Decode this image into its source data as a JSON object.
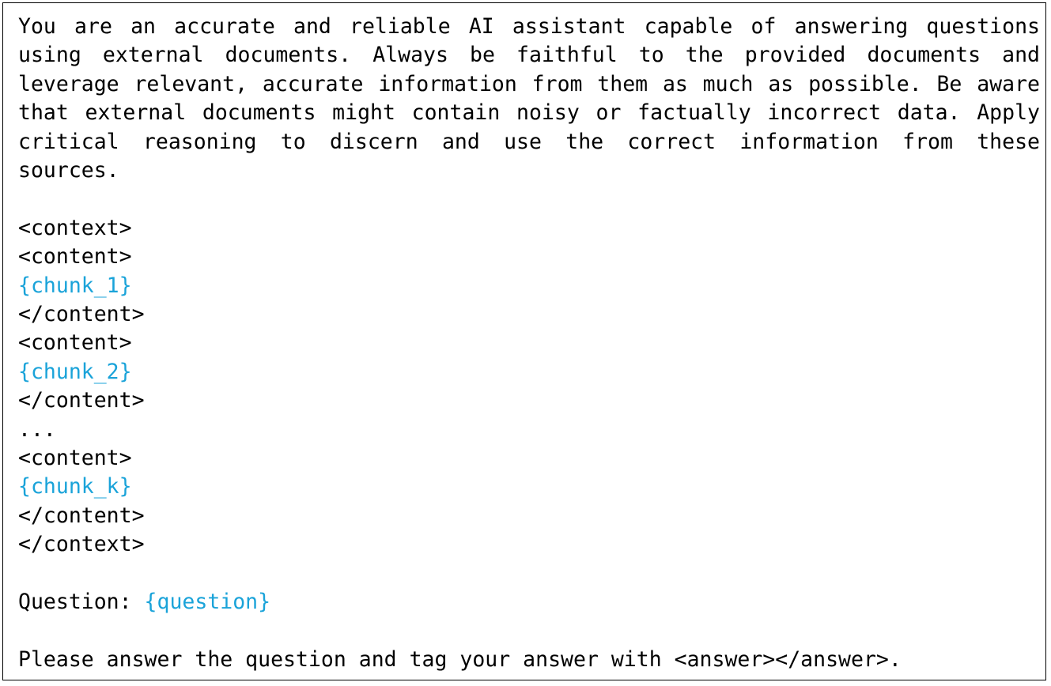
{
  "intro": "You are an accurate and reliable AI assistant capable of answering questions using external documents. Always be faithful to the provided documents and leverage relevant, accurate information from them as much as possible. Be aware that external documents might contain noisy or factually incorrect data. Apply critical reasoning to discern and use the correct information from these sources.",
  "context_open": "<context>",
  "context_close": "</context>",
  "content_open": "<content>",
  "content_close": "</content>",
  "chunks": [
    "{chunk_1}",
    "{chunk_2}",
    "{chunk_k}"
  ],
  "ellipsis": "...",
  "question_label": "Question: ",
  "question_placeholder": "{question}",
  "instruction": "Please answer the question and tag your answer with <answer></answer>.",
  "colors": {
    "placeholder": "#1aa3d9",
    "text": "#000000",
    "border": "#000000"
  }
}
